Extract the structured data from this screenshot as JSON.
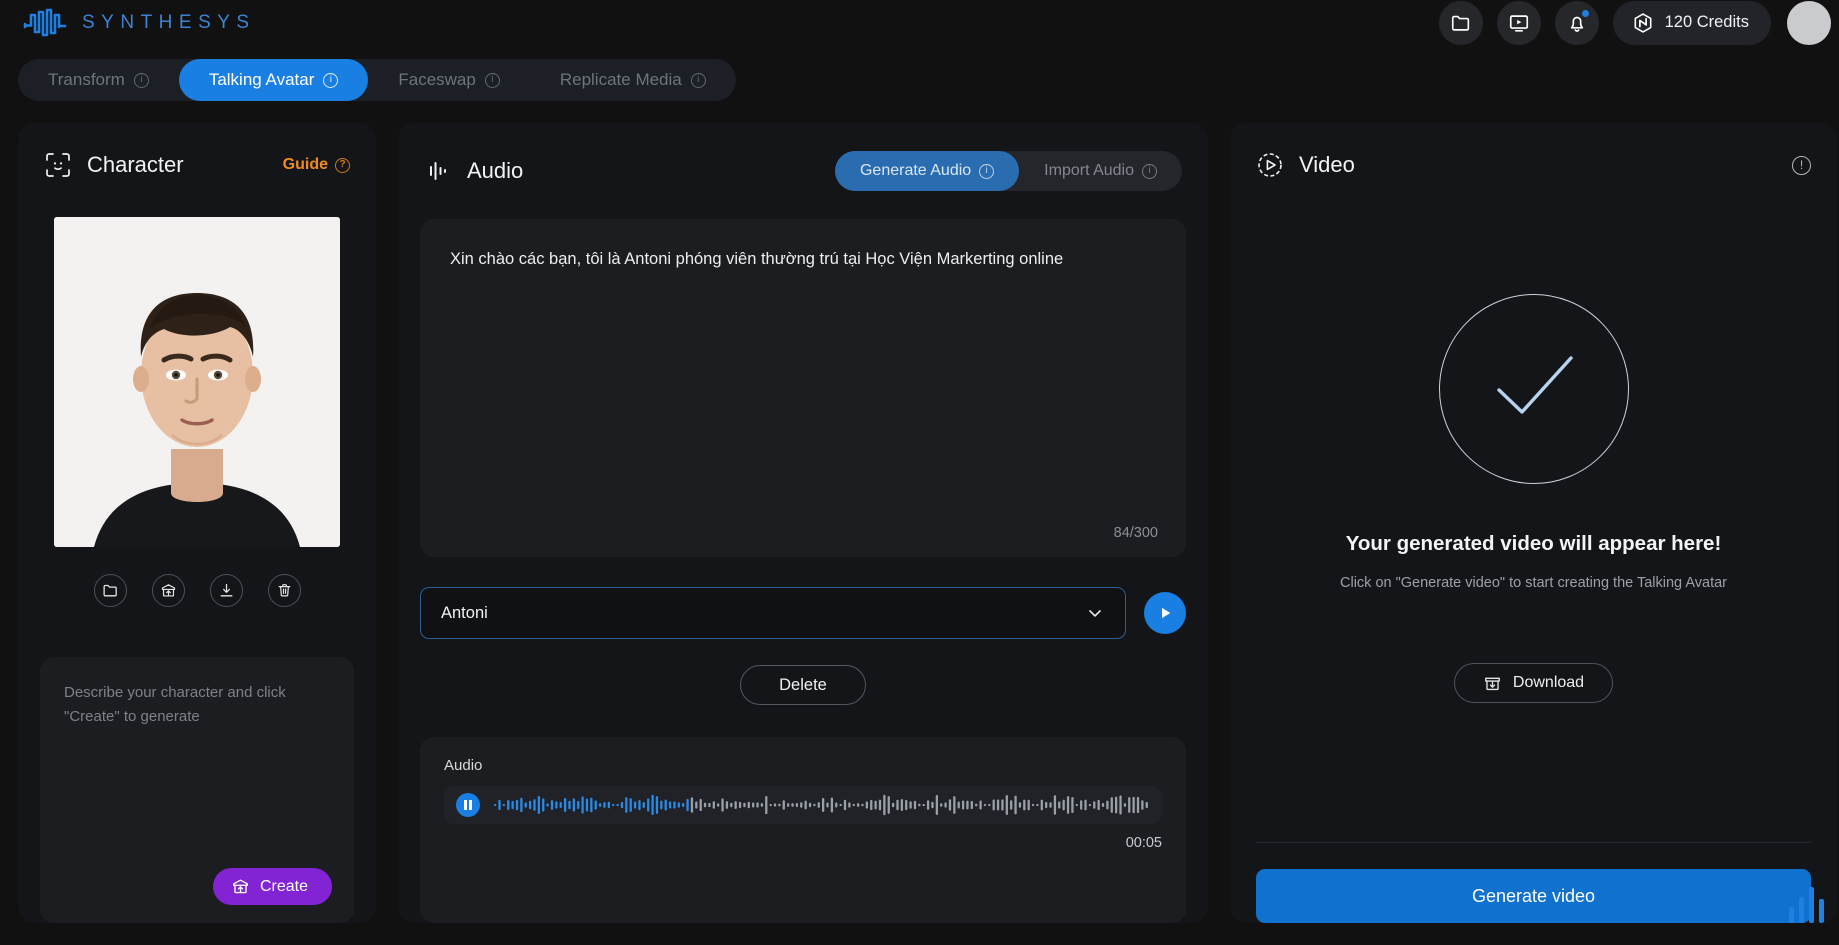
{
  "header": {
    "brand": "SYNTHESYS",
    "logo_icon": "waveform-icon",
    "icons": [
      {
        "name": "folder-icon",
        "label": "Folder"
      },
      {
        "name": "video-library-icon",
        "label": "Video Library"
      },
      {
        "name": "bell-icon",
        "label": "Notifications"
      }
    ],
    "credits_label": "120 Credits",
    "credits_icon": "credits-logo-icon",
    "accent_color": "#1a7fe3"
  },
  "tabs": [
    {
      "label": "Transform",
      "active": false,
      "info": true
    },
    {
      "label": "Talking Avatar",
      "active": true,
      "info": true
    },
    {
      "label": "Faceswap",
      "active": false,
      "info": true
    },
    {
      "label": "Replicate Media",
      "active": false,
      "info": true
    }
  ],
  "character": {
    "title": "Character",
    "title_icon": "face-scan-icon",
    "guide_label": "Guide",
    "guide_color": "#f08c1d",
    "actions": [
      {
        "name": "folder-icon",
        "label": "Browse"
      },
      {
        "name": "upload-box-icon",
        "label": "Upload"
      },
      {
        "name": "download-icon",
        "label": "Download"
      },
      {
        "name": "trash-icon",
        "label": "Delete"
      }
    ],
    "description_placeholder": "Describe your character and click \"Create\" to generate",
    "create_label": "Create",
    "create_color": "#8223d4"
  },
  "audio": {
    "title": "Audio",
    "title_icon": "audio-bars-icon",
    "modes": [
      {
        "label": "Generate Audio",
        "active": true,
        "info": true
      },
      {
        "label": "Import Audio",
        "active": false,
        "info": true
      }
    ],
    "script_text": "Xin chào các bạn, tôi là Antoni phóng viên thường trú tại Học Viện Markerting online",
    "char_count": "84/300",
    "voice_name": "Antoni",
    "delete_label": "Delete",
    "player_label": "Audio",
    "player_time": "00:05",
    "player_progress": 0.3
  },
  "video": {
    "title": "Video",
    "title_icon": "play-circle-icon",
    "info_icon": "info-icon",
    "placeholder_title": "Your generated video will appear here!",
    "placeholder_subtitle": "Click on \"Generate video\" to start creating the Talking Avatar",
    "download_label": "Download",
    "generate_label": "Generate video",
    "generate_color": "#1171cf"
  }
}
